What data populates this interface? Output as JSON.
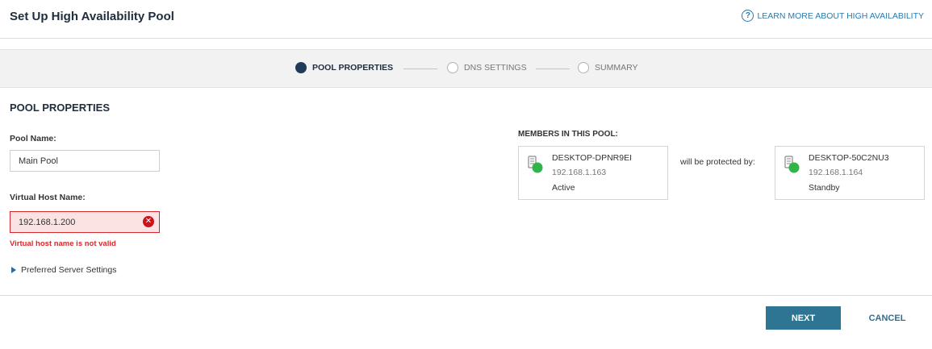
{
  "header": {
    "title": "Set Up High Availability Pool",
    "help_link": "LEARN MORE ABOUT HIGH AVAILABILITY",
    "help_icon_glyph": "?"
  },
  "stepper": {
    "steps": [
      {
        "label": "POOL PROPERTIES",
        "state": "active"
      },
      {
        "label": "DNS SETTINGS",
        "state": "inactive"
      },
      {
        "label": "SUMMARY",
        "state": "inactive"
      }
    ]
  },
  "form": {
    "section_title": "POOL PROPERTIES",
    "pool_name": {
      "label": "Pool Name:",
      "value": "Main Pool"
    },
    "virtual_host": {
      "label": "Virtual Host Name:",
      "value": "192.168.1.200",
      "error": "Virtual host name is not valid",
      "error_icon_glyph": "✕"
    },
    "preferred_server_settings": "Preferred Server Settings"
  },
  "members": {
    "label": "MEMBERS IN THIS POOL:",
    "protected_text": "will be protected by:",
    "primary": {
      "name": "DESKTOP-DPNR9EI",
      "ip": "192.168.1.163",
      "status": "Active"
    },
    "standby": {
      "name": "DESKTOP-50C2NU3",
      "ip": "192.168.1.164",
      "status": "Standby"
    }
  },
  "footer": {
    "next_label": "NEXT",
    "cancel_label": "CANCEL"
  },
  "colors": {
    "accent": "#2d7593",
    "link": "#2a7ab0",
    "error": "#d6292e",
    "status_ok": "#2fb54a",
    "active_step": "#1f3b57"
  },
  "icons": {
    "help": "help-circle-icon",
    "error": "error-x-circle-icon",
    "expander": "caret-right-icon",
    "server": "server-with-status-icon"
  }
}
